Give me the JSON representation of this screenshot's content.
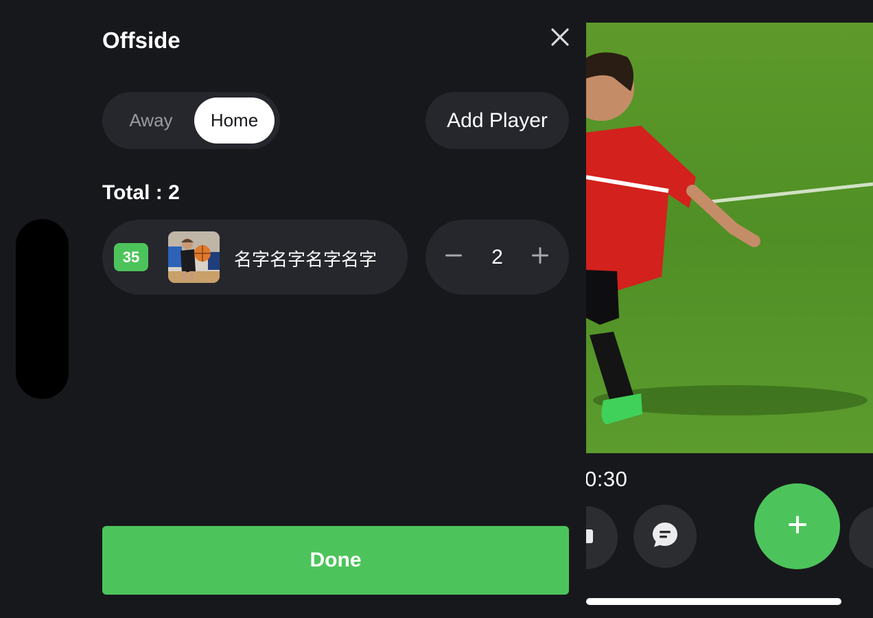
{
  "panel": {
    "title": "Offside",
    "close_icon": "close-icon",
    "team_toggle": {
      "options": [
        "Away",
        "Home"
      ],
      "selected": "Home"
    },
    "add_player_label": "Add Player",
    "total_label": "Total : 2",
    "players": [
      {
        "jersey_number": "35",
        "photo_icon": "player-photo",
        "name": "名字名字名字名字",
        "count": "2"
      }
    ],
    "done_label": "Done"
  },
  "video": {
    "timecode": "0:30",
    "buttons": [
      "stop-icon",
      "comment-icon",
      "plus-icon",
      "more-icon"
    ]
  },
  "colors": {
    "background": "#17181c",
    "surface": "#26272d",
    "accent": "#4dc45b",
    "muted_text": "#9a9ba1"
  }
}
